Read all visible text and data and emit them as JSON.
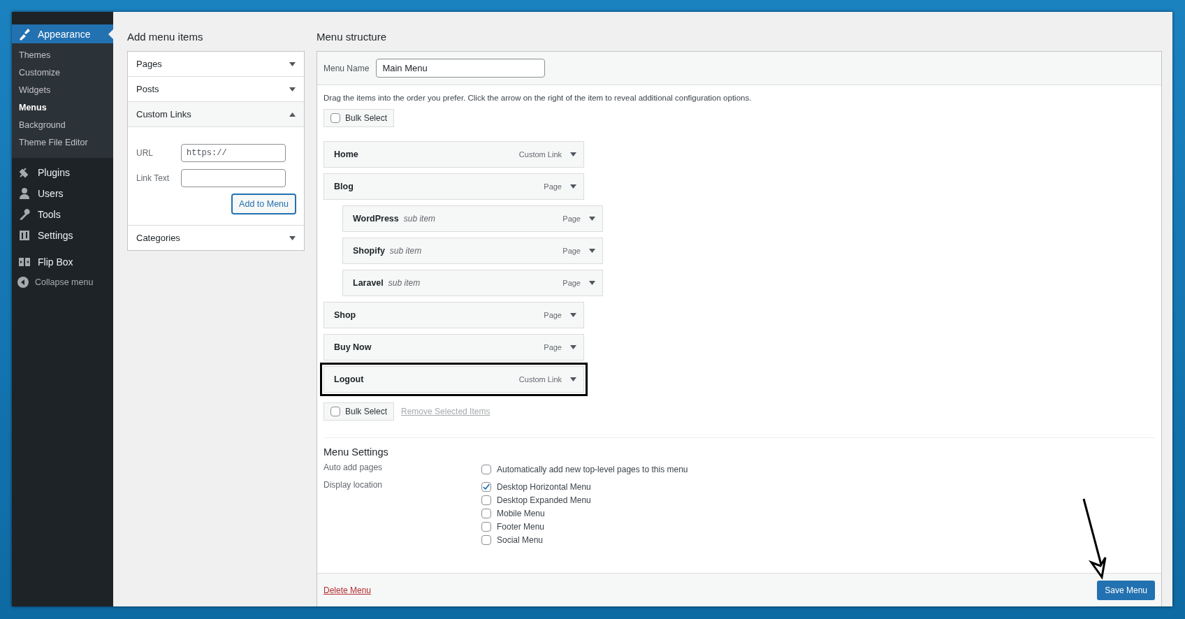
{
  "sidebar": {
    "submenu": [
      {
        "label": "Themes",
        "selected": false
      },
      {
        "label": "Customize",
        "selected": false
      },
      {
        "label": "Widgets",
        "selected": false
      },
      {
        "label": "Menus",
        "selected": true
      },
      {
        "label": "Background",
        "selected": false
      },
      {
        "label": "Theme File Editor",
        "selected": false
      }
    ],
    "items": [
      {
        "label": "Appearance",
        "selected": true
      },
      {
        "label": "Plugins",
        "selected": false
      },
      {
        "label": "Users",
        "selected": false
      },
      {
        "label": "Tools",
        "selected": false
      },
      {
        "label": "Settings",
        "selected": false
      },
      {
        "label": "Flip Box",
        "selected": false
      }
    ],
    "collapse": "Collapse menu"
  },
  "add_menu_items": {
    "title": "Add menu items",
    "sections": [
      {
        "label": "Pages",
        "expanded": false
      },
      {
        "label": "Posts",
        "expanded": false
      },
      {
        "label": "Custom Links",
        "expanded": true,
        "form": {
          "url_label": "URL",
          "url_value": "https://",
          "link_text_label": "Link Text",
          "button": "Add to Menu"
        }
      },
      {
        "label": "Categories",
        "expanded": false
      }
    ]
  },
  "menu_structure": {
    "title": "Menu structure",
    "menu_name_label": "Menu Name",
    "menu_name_value": "Main Menu",
    "instructions": "Drag the items into the order you prefer. Click the arrow on the right of the item to reveal additional configuration options.",
    "bulk_select_top": {
      "label": "Bulk Select",
      "checked": false
    },
    "items": [
      {
        "title": "Home",
        "type": "Custom Link",
        "highlighted": false
      },
      {
        "title": "Blog",
        "type": "Page",
        "highlighted": false,
        "children": [
          {
            "title": "WordPress",
            "note": "sub item",
            "type": "Page"
          },
          {
            "title": "Shopify",
            "note": "sub item",
            "type": "Page"
          },
          {
            "title": "Laravel",
            "note": "sub item",
            "type": "Page"
          }
        ]
      },
      {
        "title": "Shop",
        "type": "Page",
        "highlighted": false
      },
      {
        "title": "Buy Now",
        "type": "Page",
        "highlighted": false
      },
      {
        "title": "Logout",
        "type": "Custom Link",
        "highlighted": true
      }
    ],
    "bulk_select_bottom": {
      "label": "Bulk Select",
      "checked": false
    },
    "remove_link": "Remove Selected Items",
    "settings": {
      "title": "Menu Settings",
      "auto_add_label": "Auto add pages",
      "auto_add": {
        "label": "Automatically add new top-level pages to this menu",
        "checked": false
      },
      "display_label": "Display location",
      "locations": [
        {
          "label": "Desktop Horizontal Menu",
          "checked": true
        },
        {
          "label": "Desktop Expanded Menu",
          "checked": false
        },
        {
          "label": "Mobile Menu",
          "checked": false
        },
        {
          "label": "Footer Menu",
          "checked": false
        },
        {
          "label": "Social Menu",
          "checked": false
        }
      ]
    },
    "delete_link": "Delete Menu",
    "save_button": "Save Menu"
  }
}
